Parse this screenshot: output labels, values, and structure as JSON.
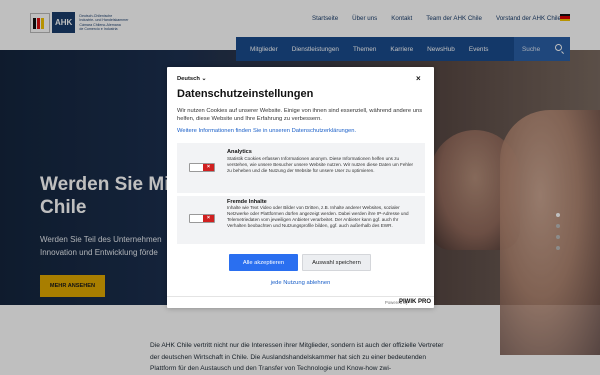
{
  "header": {
    "logo_abbr": "AHK",
    "logo_lines": [
      "Deutsch-Chilenische",
      "Industrie- und Handelskammer",
      "Cámara Chileno-Alemana",
      "de Comercio e Industria"
    ],
    "topnav": [
      "Startseite",
      "Über uns",
      "Kontakt",
      "Team der AHK Chile",
      "Vorstand der AHK Chile"
    ],
    "language_flag": "germany-flag-icon"
  },
  "mainnav": {
    "items": [
      "Mitglieder",
      "Dienstleistungen",
      "Themen",
      "Karriere",
      "NewsHub",
      "Events"
    ],
    "search_label": "Suche",
    "accent": "#1a4b8d"
  },
  "hero": {
    "title": "Werden Sie Mit",
    "title_line2": "Chile",
    "text_line1": "Werden Sie Teil des Unternehmen",
    "text_line2": "Innovation und Entwicklung förde",
    "button": "MEHR ANSEHEN",
    "slides_total": 4,
    "slide_active": 1
  },
  "lower_text": "Die AHK Chile vertritt nicht nur die Interessen ihrer Mitglieder, sondern ist auch der offizielle Vertreter der deutschen Wirtschaft in Chile. Die Auslandshandelskammer hat sich zu einer bedeutenden Plattform für den Austausch und den Transfer von Technologie und Know-how zwi-",
  "consent": {
    "language": "Deutsch",
    "close_symbol": "×",
    "title": "Datenschutzeinstellungen",
    "intro": "Wir nutzen Cookies auf unserer Website. Einige von ihnen sind essenziell, während andere uns helfen, diese Website und Ihre Erfahrung zu verbessern.",
    "more_link": "Weitere Informationen finden Sie in unseren Datenschutzerklärungen.",
    "categories": [
      {
        "name": "Analytics",
        "description": "Statistik Cookies erfassen Informationen anonym. Diese Informationen helfen uns zu verstehen, wie unsere Besucher unsere Website nutzen. Wir nutzen diese Daten um Fehler zu beheben und die Nutzung der Website für unsere User zu optimieren.",
        "enabled": false
      },
      {
        "name": "Fremde Inhalte",
        "description": "Inhalte wie Text Video oder Bilder von Dritten, z.B. Inhalte anderer Websites, sozialer Netzwerke oder Plattformen dürfen angezeigt werden. Dabei werden ihre IP-Adresse und Telemetriedaten vom jeweiligen Anbieter verarbeitet. Der Anbieter kann ggf. auch Ihr Verhalten beobachten und Nutzungsprofile bilden, ggf. auch außerhalb des EWR.",
        "enabled": false
      }
    ],
    "accept_all": "Alle akzeptieren",
    "save_selection": "Auswahl speichern",
    "reject_link": "jede Nutzung ablehnen",
    "powered_by": "Powered by",
    "brand": "PIWIK PRO",
    "accept_color": "#2a6ff0"
  }
}
